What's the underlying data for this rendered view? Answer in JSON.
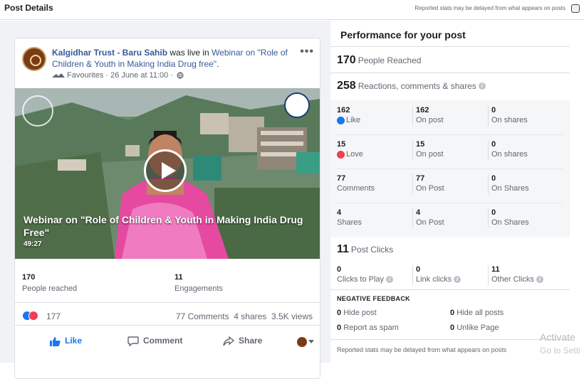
{
  "header": {
    "title": "Post Details",
    "note": "Reported stats may be delayed from what appears on posts"
  },
  "post": {
    "page_name": "Kalgidhar Trust - Baru Sahib",
    "live_text": " was live in ",
    "event_link": "Webinar on \"Role of Children & Youth in Making India Drug free\"",
    "event_suffix": ".",
    "meta": "Favourites · 26 June at 11:00 ·",
    "video_title": "Webinar on \"Role of Children & Youth in Making India Drug Free\"",
    "video_duration": "49:27",
    "people_reached_value": "170",
    "people_reached_label": "People reached",
    "engagements_value": "11",
    "engagements_label": "Engagements",
    "reaction_count": "177",
    "comments": "77 Comments",
    "shares": "4 shares",
    "views": "3.5K views",
    "actions": {
      "like": "Like",
      "comment": "Comment",
      "share": "Share"
    }
  },
  "performance": {
    "title": "Performance for your post",
    "reached_value": "170",
    "reached_label": "People Reached",
    "reactions_value": "258",
    "reactions_label": "Reactions, comments & shares",
    "breakdown": [
      {
        "a_n": "162",
        "a_l": "Like",
        "b_n": "162",
        "b_l": "On post",
        "c_n": "0",
        "c_l": "On shares"
      },
      {
        "a_n": "15",
        "a_l": "Love",
        "b_n": "15",
        "b_l": "On post",
        "c_n": "0",
        "c_l": "On shares"
      },
      {
        "a_n": "77",
        "a_l": "Comments",
        "b_n": "77",
        "b_l": "On Post",
        "c_n": "0",
        "c_l": "On Shares"
      },
      {
        "a_n": "4",
        "a_l": "Shares",
        "b_n": "4",
        "b_l": "On Post",
        "c_n": "0",
        "c_l": "On Shares"
      }
    ],
    "clicks_value": "11",
    "clicks_label": "Post Clicks",
    "clicks": [
      {
        "n": "0",
        "l": "Clicks to Play"
      },
      {
        "n": "0",
        "l": "Link clicks"
      },
      {
        "n": "11",
        "l": "Other Clicks"
      }
    ],
    "negative_title": "NEGATIVE FEEDBACK",
    "negative": [
      {
        "n": "0",
        "l": "Hide post"
      },
      {
        "n": "0",
        "l": "Hide all posts"
      },
      {
        "n": "0",
        "l": "Report as spam"
      },
      {
        "n": "0",
        "l": "Unlike Page"
      }
    ],
    "footer_note": "Reported stats may be delayed from what appears on posts"
  },
  "watermark": {
    "line1": "Activate",
    "line2": "Go to Setti"
  },
  "colors": {
    "accent": "#1877f2",
    "love": "#f33e58",
    "link": "#385898"
  },
  "icons": [
    "more-icon",
    "globe-icon",
    "play-icon",
    "like-icon",
    "comment-icon",
    "share-icon",
    "info-icon",
    "close-icon"
  ]
}
